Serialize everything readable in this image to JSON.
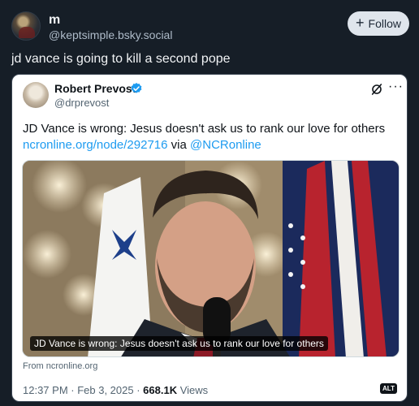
{
  "post": {
    "display_name": "m",
    "handle": "@keptsimple.bsky.social",
    "follow_label": "Follow",
    "text": "jd vance is going to kill a second pope"
  },
  "embed": {
    "author_name": "Robert Prevost",
    "author_handle": "@drprevost",
    "text_line1": "JD Vance is wrong: Jesus doesn't ask us to rank our love for others",
    "link_url": "ncronline.org/node/292716",
    "via_word": "via",
    "mention": "@NCRonline",
    "media_caption": "JD Vance is wrong: Jesus doesn't ask us to rank our love for others",
    "from_line": "From ncronline.org",
    "timestamp": "12:37 PM · Feb 3, 2025 ·",
    "views_count": "668.1K",
    "views_label": "Views",
    "alt_badge": "ALT",
    "more_glyph": "···"
  },
  "icons": {
    "follow": "plus-icon",
    "verified": "verified-badge-icon",
    "grok": "grok-icon",
    "more": "more-horizontal-icon"
  },
  "colors": {
    "background": "#161e27",
    "link": "#1d9bf0",
    "verified": "#1d9bf0"
  }
}
